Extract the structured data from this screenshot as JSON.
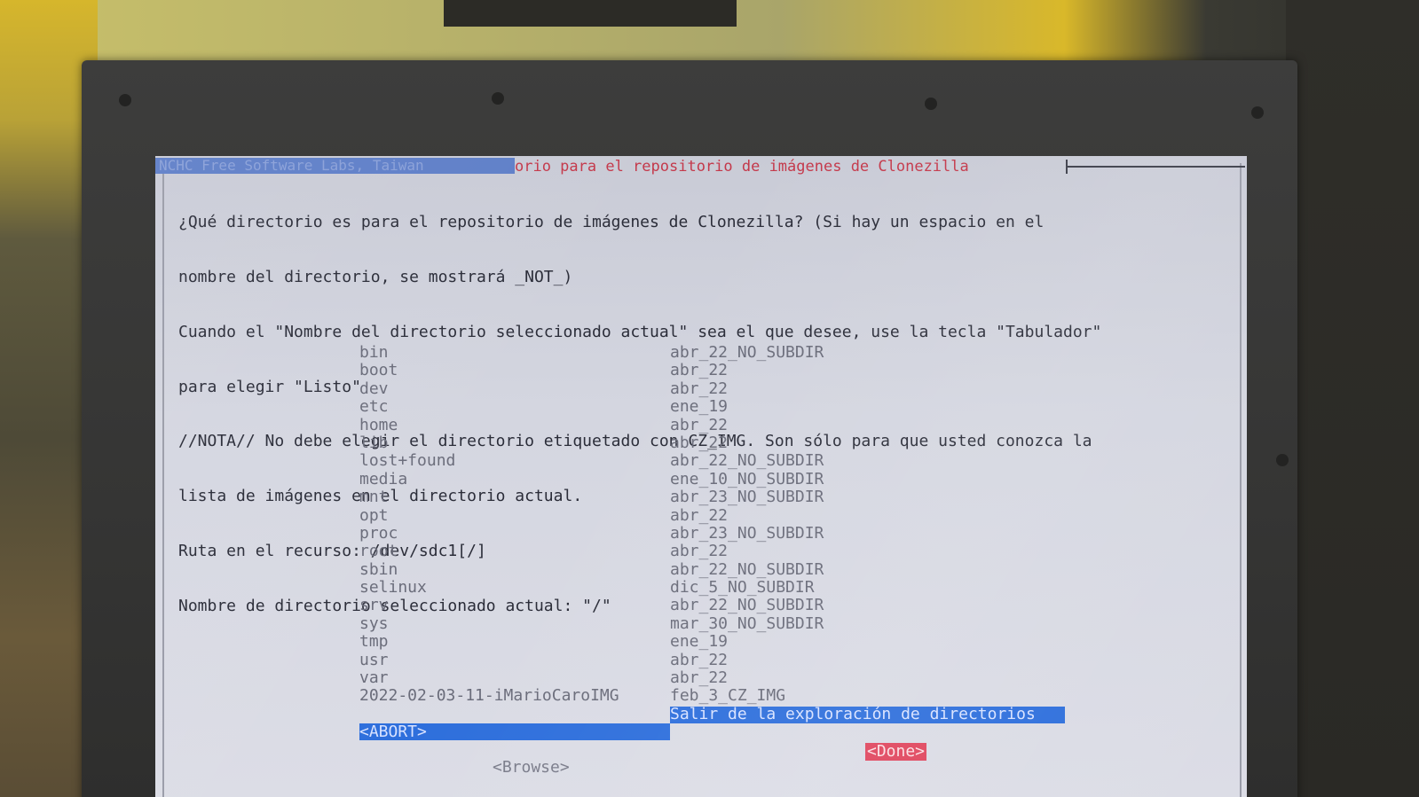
{
  "dialog": {
    "title_hidden": "NCHC Free Software Labs, Taiwan",
    "title": "orio para el repositorio de imágenes de Clonezilla",
    "message_lines": [
      "¿Qué directorio es para el repositorio de imágenes de Clonezilla? (Si hay un espacio en el",
      "nombre del directorio, se mostrará _NOT_)",
      "Cuando el \"Nombre del directorio seleccionado actual\" sea el que desee, use la tecla \"Tabulador\"",
      "para elegir \"Listo\"",
      "//NOTA// No debe elegir el directorio etiquetado con CZ_IMG. Son sólo para que usted conozca la",
      "lista de imágenes en el directorio actual.",
      "Ruta en el recurso: /dev/sdc1[/]",
      "Nombre de directorio seleccionado actual: \"/\""
    ]
  },
  "entries": [
    {
      "name": "bin",
      "desc": "abr_22_NO_SUBDIR"
    },
    {
      "name": "boot",
      "desc": "abr_22"
    },
    {
      "name": "dev",
      "desc": "abr_22"
    },
    {
      "name": "etc",
      "desc": "ene_19"
    },
    {
      "name": "home",
      "desc": "abr_22"
    },
    {
      "name": "lib",
      "desc": "abr_22"
    },
    {
      "name": "lost+found",
      "desc": "abr_22_NO_SUBDIR"
    },
    {
      "name": "media",
      "desc": "ene_10_NO_SUBDIR"
    },
    {
      "name": "mnt",
      "desc": "abr_23_NO_SUBDIR"
    },
    {
      "name": "opt",
      "desc": "abr_22"
    },
    {
      "name": "proc",
      "desc": "abr_23_NO_SUBDIR"
    },
    {
      "name": "root",
      "desc": "abr_22"
    },
    {
      "name": "sbin",
      "desc": "abr_22_NO_SUBDIR"
    },
    {
      "name": "selinux",
      "desc": "dic_5_NO_SUBDIR"
    },
    {
      "name": "srv",
      "desc": "abr_22_NO_SUBDIR"
    },
    {
      "name": "sys",
      "desc": "mar_30_NO_SUBDIR"
    },
    {
      "name": "tmp",
      "desc": "ene_19"
    },
    {
      "name": "usr",
      "desc": "abr_22"
    },
    {
      "name": "var",
      "desc": "abr_22"
    },
    {
      "name": "2022-02-03-11-iMarioCaroIMG",
      "desc": "feb_3_CZ_IMG"
    },
    {
      "name": "",
      "desc": "Salir de la exploración de directorios"
    },
    {
      "name": "<ABORT>",
      "desc": ""
    }
  ],
  "buttons": {
    "done": "<Done>",
    "browse": "<Browse>"
  },
  "colors": {
    "dialog_bg": "#d4d6e0",
    "title_red": "#c4384a",
    "selection_blue": "#2e6fdc",
    "done_red": "#e0465e"
  }
}
